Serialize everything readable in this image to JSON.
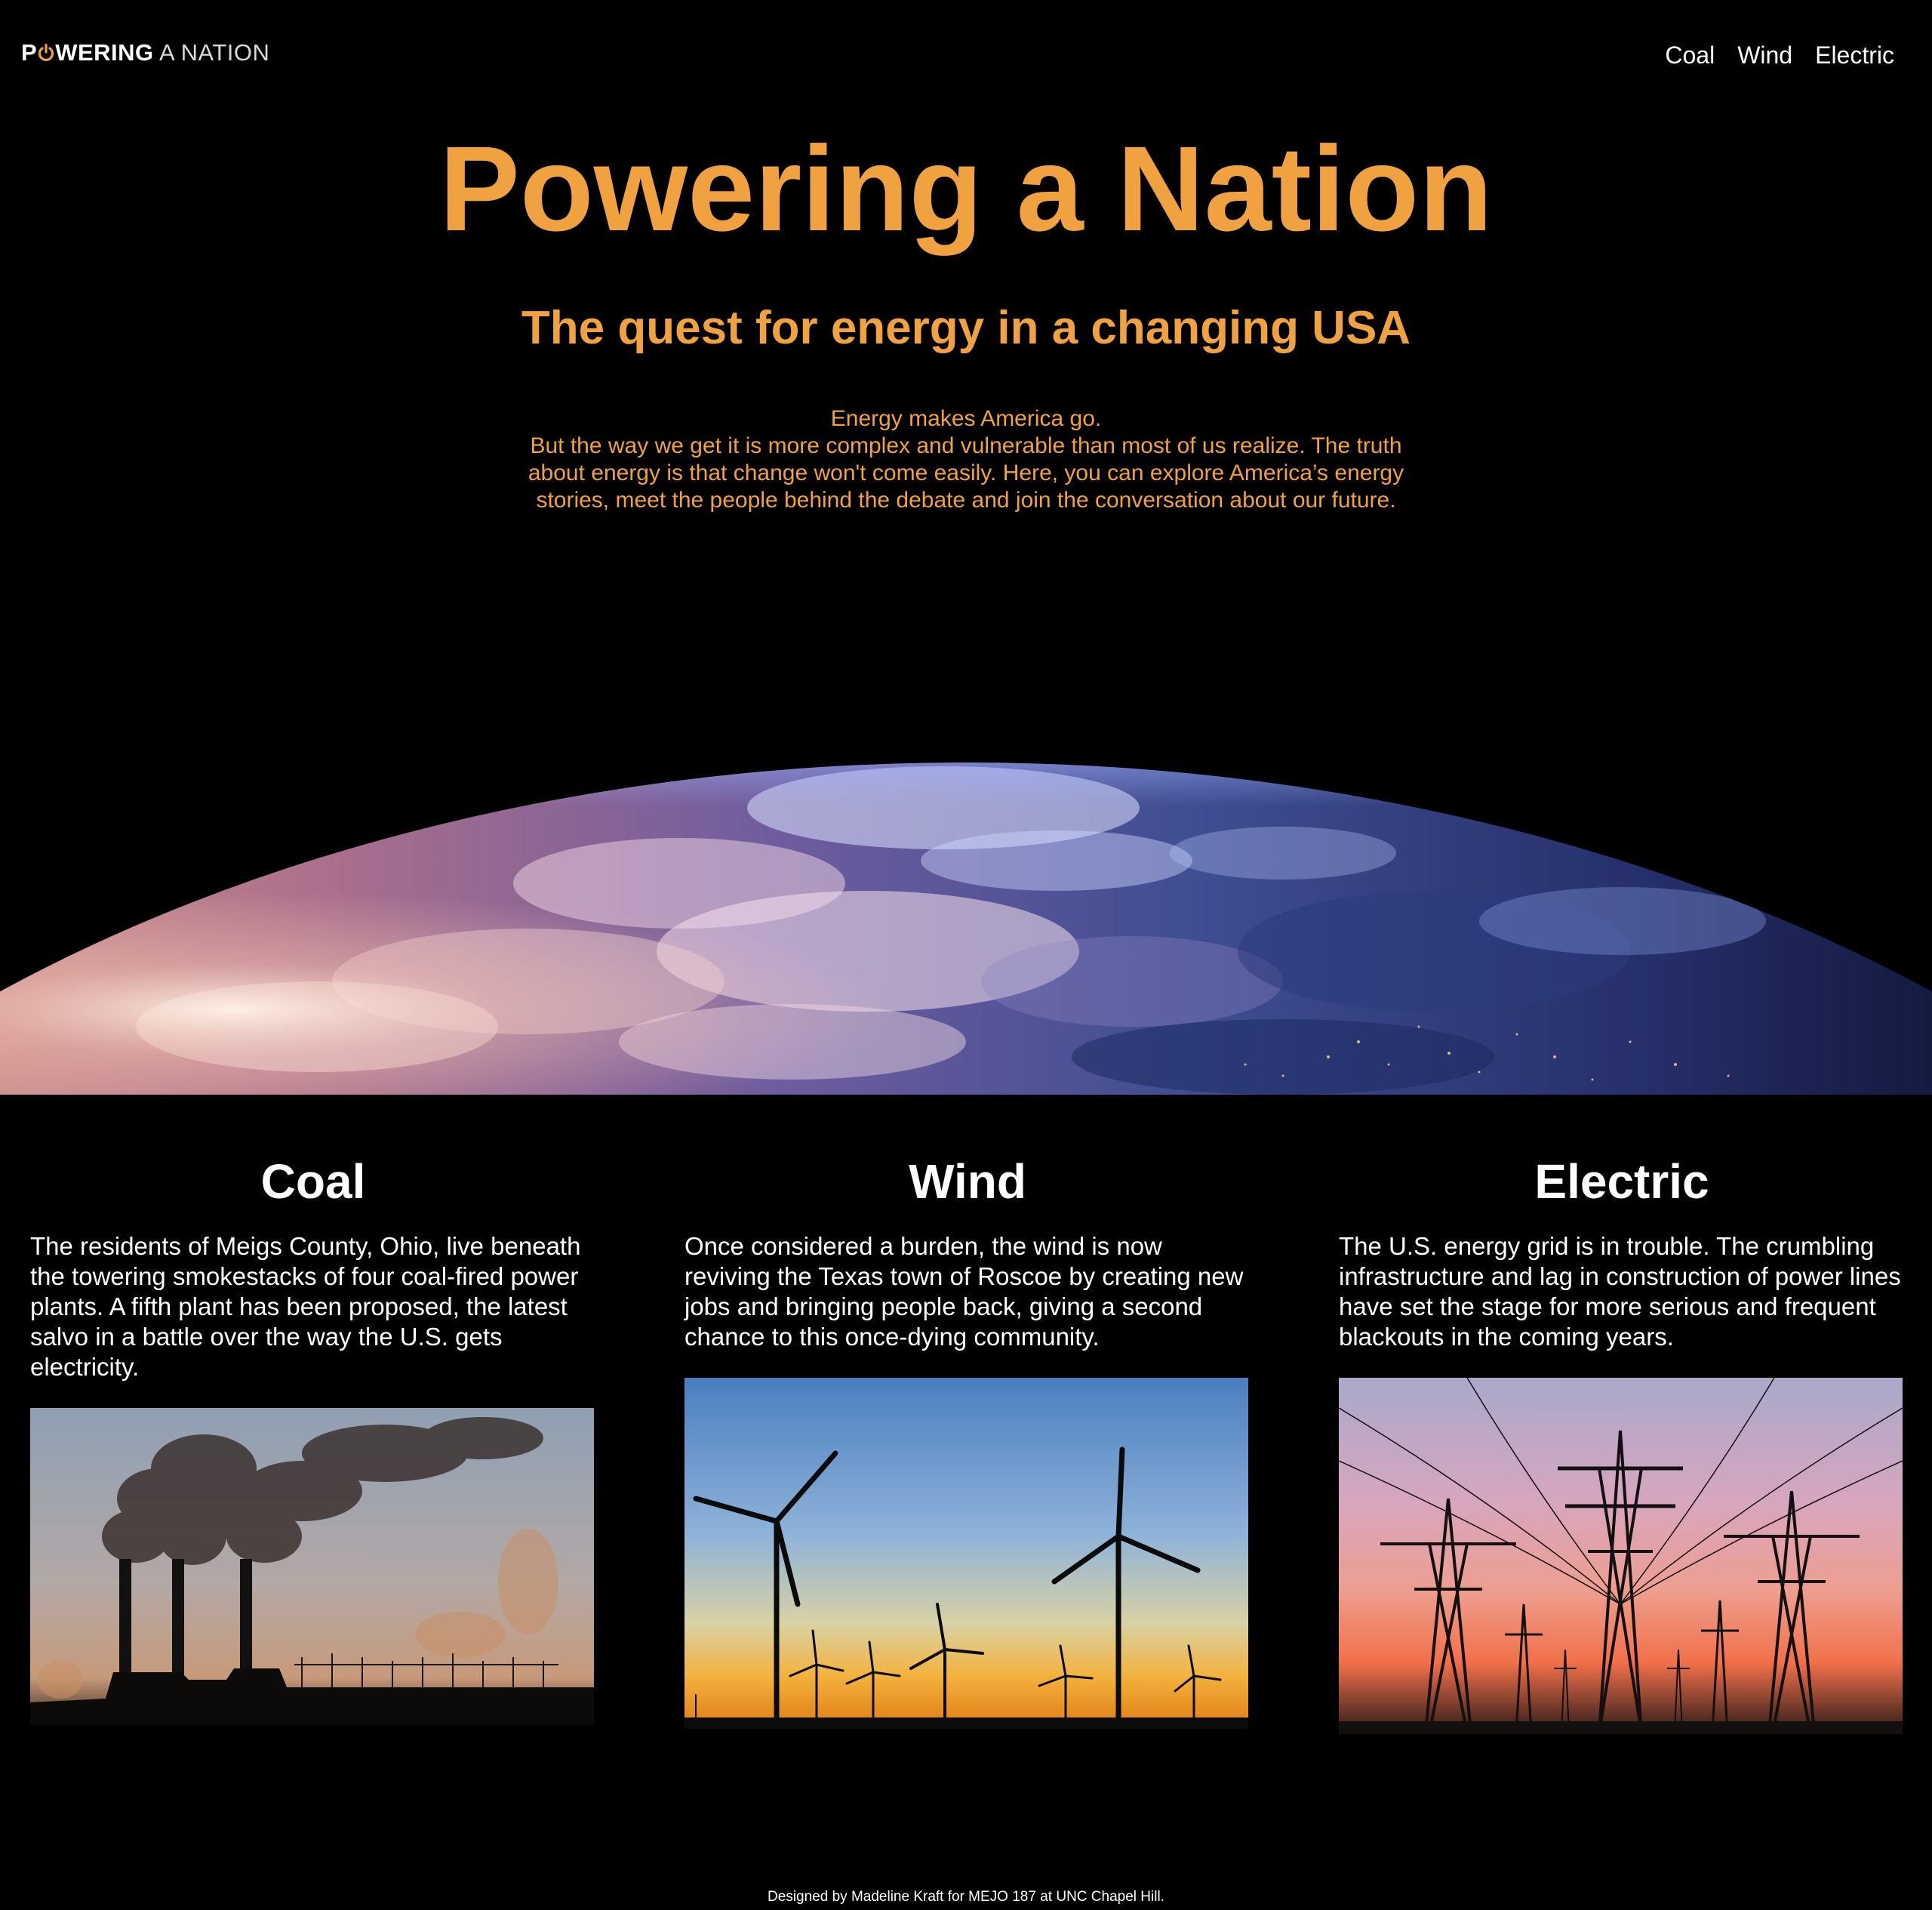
{
  "header": {
    "logo": {
      "part1": "P",
      "part2": "WERING",
      "part3": "A NATION"
    },
    "nav": [
      {
        "label": "Coal"
      },
      {
        "label": "Wind"
      },
      {
        "label": "Electric"
      }
    ]
  },
  "hero": {
    "title": "Powering a Nation",
    "subtitle": "The quest for energy in a changing USA",
    "intro_line1": "Energy makes America go.",
    "intro_body": "But the way we get it is more complex and vulnerable than most of us realize. The truth about energy is that change won't come easily. Here, you can explore America’s energy stories, meet the people behind the debate and join the conversation about our future."
  },
  "sections": [
    {
      "title": "Coal",
      "text": "The residents of Meigs County, Ohio, live beneath the towering smokestacks of four coal-fired power plants. A fifth plant has been proposed, the latest salvo in a battle over the way the U.S. gets electricity."
    },
    {
      "title": "Wind",
      "text": "Once considered a burden, the wind is now reviving the Texas town of Roscoe by creating new jobs and bringing people back, giving a second chance to this once-dying community."
    },
    {
      "title": "Electric",
      "text": "The U.S. energy grid is in trouble. The crumbling infrastructure and lag in construction of power lines have set the stage for more serious and frequent blackouts in the coming years."
    }
  ],
  "footer": {
    "credit": "Designed by Madeline Kraft for MEJO 187 at UNC Chapel Hill."
  },
  "colors": {
    "accent": "#f0a140",
    "background": "#000000",
    "text": "#ffffff"
  }
}
